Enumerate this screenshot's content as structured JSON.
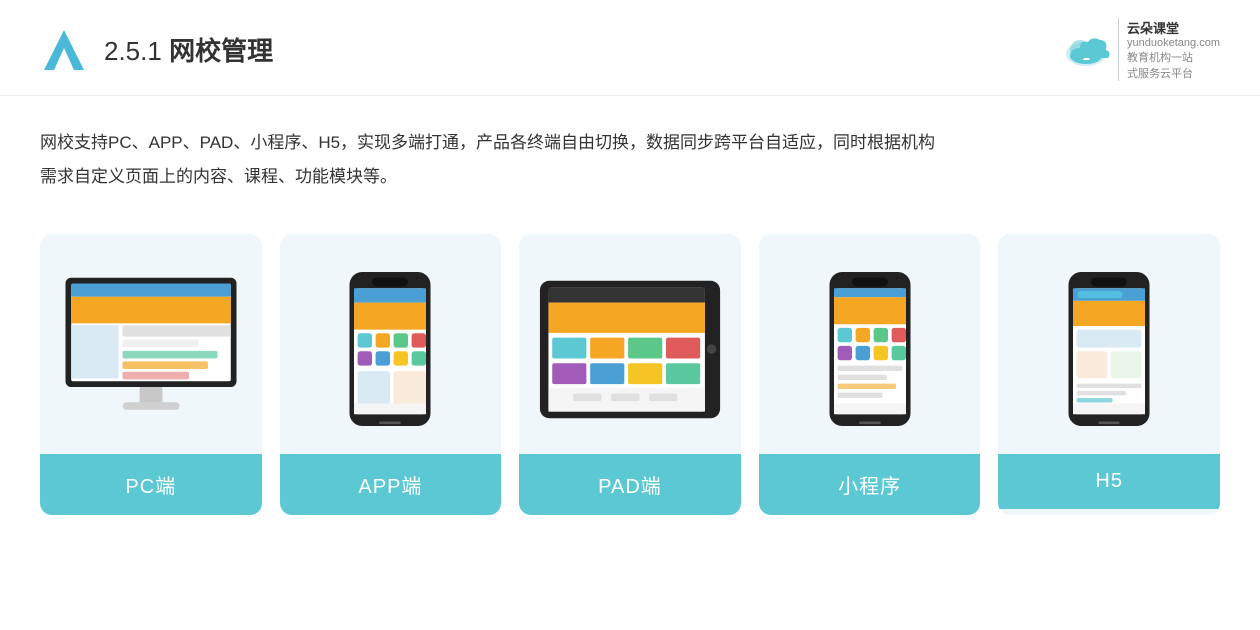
{
  "header": {
    "title_prefix": "2.5.1 ",
    "title_main": "网校管理",
    "brand": {
      "name": "云朵课堂",
      "url": "yunduoketang.com",
      "slogan_line1": "教育机构一站",
      "slogan_line2": "式服务云平台"
    }
  },
  "description": {
    "text_line1": "网校支持PC、APP、PAD、小程序、H5，实现多端打通，产品各终端自由切换，数据同步跨平台自适应，同时根据机构",
    "text_line2": "需求自定义页面上的内容、课程、功能模块等。"
  },
  "cards": [
    {
      "id": "pc",
      "label": "PC端",
      "type": "desktop"
    },
    {
      "id": "app",
      "label": "APP端",
      "type": "phone"
    },
    {
      "id": "pad",
      "label": "PAD端",
      "type": "tablet"
    },
    {
      "id": "miniapp",
      "label": "小程序",
      "type": "phone"
    },
    {
      "id": "h5",
      "label": "H5",
      "type": "phone"
    }
  ]
}
